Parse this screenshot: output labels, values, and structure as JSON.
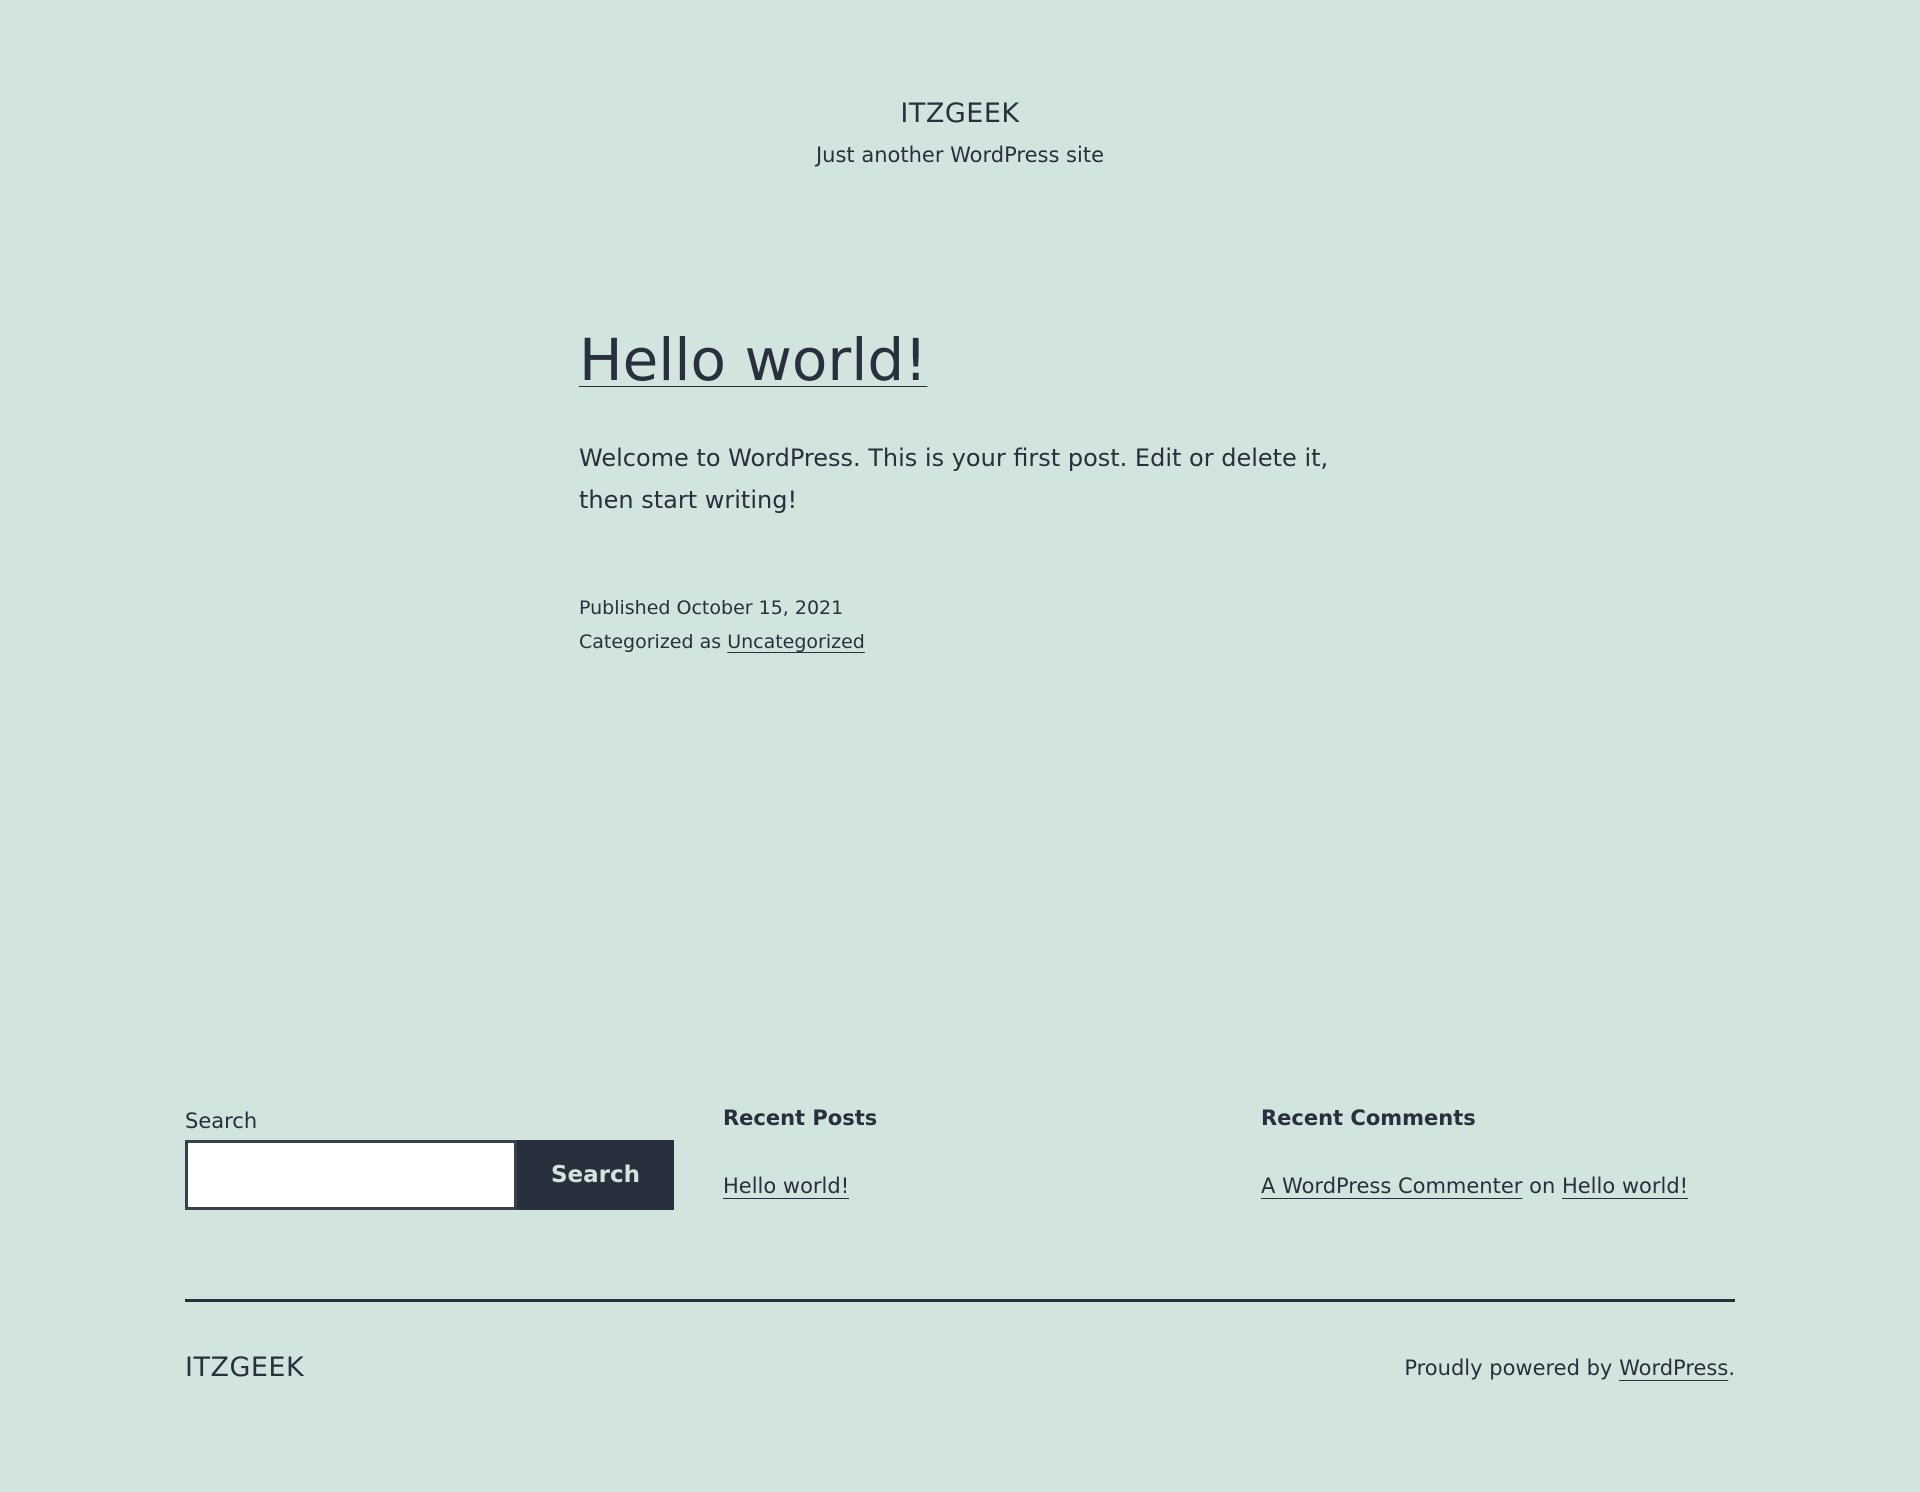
{
  "header": {
    "site_title": "ITZGEEK",
    "site_description": "Just another WordPress site"
  },
  "post": {
    "title": "Hello world!",
    "content": "Welcome to WordPress. This is your first post. Edit or delete it, then start writing!",
    "published_label": "Published",
    "published_date": "October 15, 2021",
    "categorized_label": "Categorized as",
    "category": "Uncategorized"
  },
  "widgets": {
    "search": {
      "label": "Search",
      "input_value": "",
      "button_label": "Search"
    },
    "recent_posts": {
      "title": "Recent Posts",
      "items": [
        "Hello world!"
      ]
    },
    "recent_comments": {
      "title": "Recent Comments",
      "author": "A WordPress Commenter",
      "connector": "on",
      "post": "Hello world!"
    }
  },
  "footer": {
    "site_title": "ITZGEEK",
    "powered_prefix": "Proudly powered by",
    "powered_link": "WordPress",
    "powered_suffix": "."
  },
  "colors": {
    "background": "#d1e4dd",
    "text": "#28303d",
    "button_bg": "#28303d",
    "button_text": "#d1e4dd"
  }
}
